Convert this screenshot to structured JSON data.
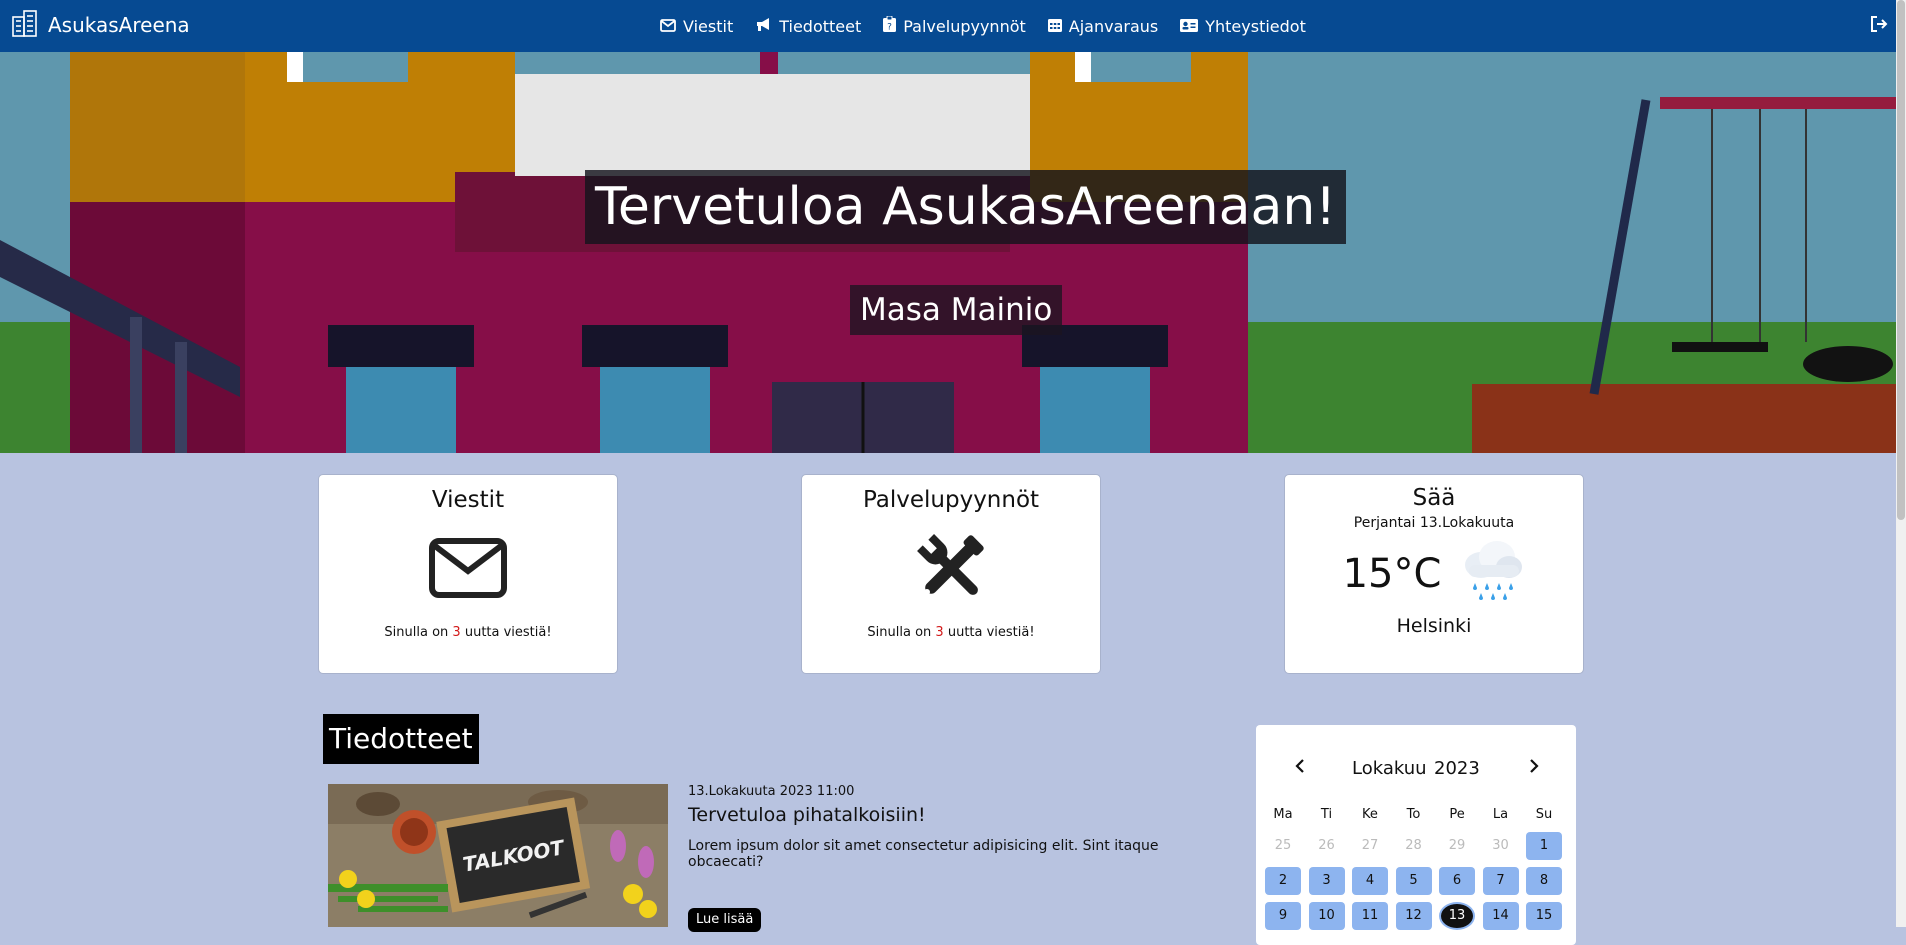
{
  "navbar": {
    "brand": "AsukasAreena",
    "links": [
      {
        "label": "Viestit",
        "icon": "envelope-icon"
      },
      {
        "label": "Tiedotteet",
        "icon": "megaphone-icon"
      },
      {
        "label": "Palvelupyynnöt",
        "icon": "request-icon"
      },
      {
        "label": "Ajanvaraus",
        "icon": "calendar-icon"
      },
      {
        "label": "Yhteystiedot",
        "icon": "contact-card-icon"
      }
    ],
    "logout_icon": "logout-icon"
  },
  "hero": {
    "title": "Tervetuloa AsukasAreenaan!",
    "user_name": "Masa Mainio"
  },
  "cards": {
    "messages": {
      "title": "Viestit",
      "text_before": "Sinulla on ",
      "count": "3",
      "text_after": " uutta viestiä!"
    },
    "requests": {
      "title": "Palvelupyynnöt",
      "text_before": "Sinulla on ",
      "count": "3",
      "text_after": " uutta viestiä!"
    },
    "weather": {
      "title": "Sää",
      "date": "Perjantai 13.Lokakuuta",
      "temperature": "15°C",
      "city": "Helsinki",
      "icon": "rain-cloud-icon"
    }
  },
  "announcements": {
    "section_title": "Tiedotteet",
    "items": [
      {
        "date": "13.Lokakuuta 2023 11:00",
        "title": "Tervetuloa pihatalkoisiin!",
        "body": "Lorem ipsum dolor sit amet consectetur adipisicing elit. Sint itaque obcaecati?",
        "button": "Lue lisää",
        "image_sign": "TALKOOT"
      }
    ]
  },
  "calendar": {
    "month": "Lokakuu",
    "year": "2023",
    "weekdays": [
      "Ma",
      "Ti",
      "Ke",
      "To",
      "Pe",
      "La",
      "Su"
    ],
    "days": [
      {
        "n": "25",
        "state": "muted"
      },
      {
        "n": "26",
        "state": "muted"
      },
      {
        "n": "27",
        "state": "muted"
      },
      {
        "n": "28",
        "state": "muted"
      },
      {
        "n": "29",
        "state": "muted"
      },
      {
        "n": "30",
        "state": "muted"
      },
      {
        "n": "1",
        "state": "cur"
      },
      {
        "n": "2",
        "state": "cur"
      },
      {
        "n": "3",
        "state": "cur"
      },
      {
        "n": "4",
        "state": "cur"
      },
      {
        "n": "5",
        "state": "cur"
      },
      {
        "n": "6",
        "state": "cur"
      },
      {
        "n": "7",
        "state": "cur"
      },
      {
        "n": "8",
        "state": "cur"
      },
      {
        "n": "9",
        "state": "cur"
      },
      {
        "n": "10",
        "state": "cur"
      },
      {
        "n": "11",
        "state": "cur"
      },
      {
        "n": "12",
        "state": "cur"
      },
      {
        "n": "13",
        "state": "today"
      },
      {
        "n": "14",
        "state": "cur"
      },
      {
        "n": "15",
        "state": "cur"
      }
    ]
  },
  "colors": {
    "navbar": "#064a92",
    "page_bg": "#b8c3e0",
    "accent_count": "#d21a1a",
    "calendar_day": "#8db4ef"
  }
}
